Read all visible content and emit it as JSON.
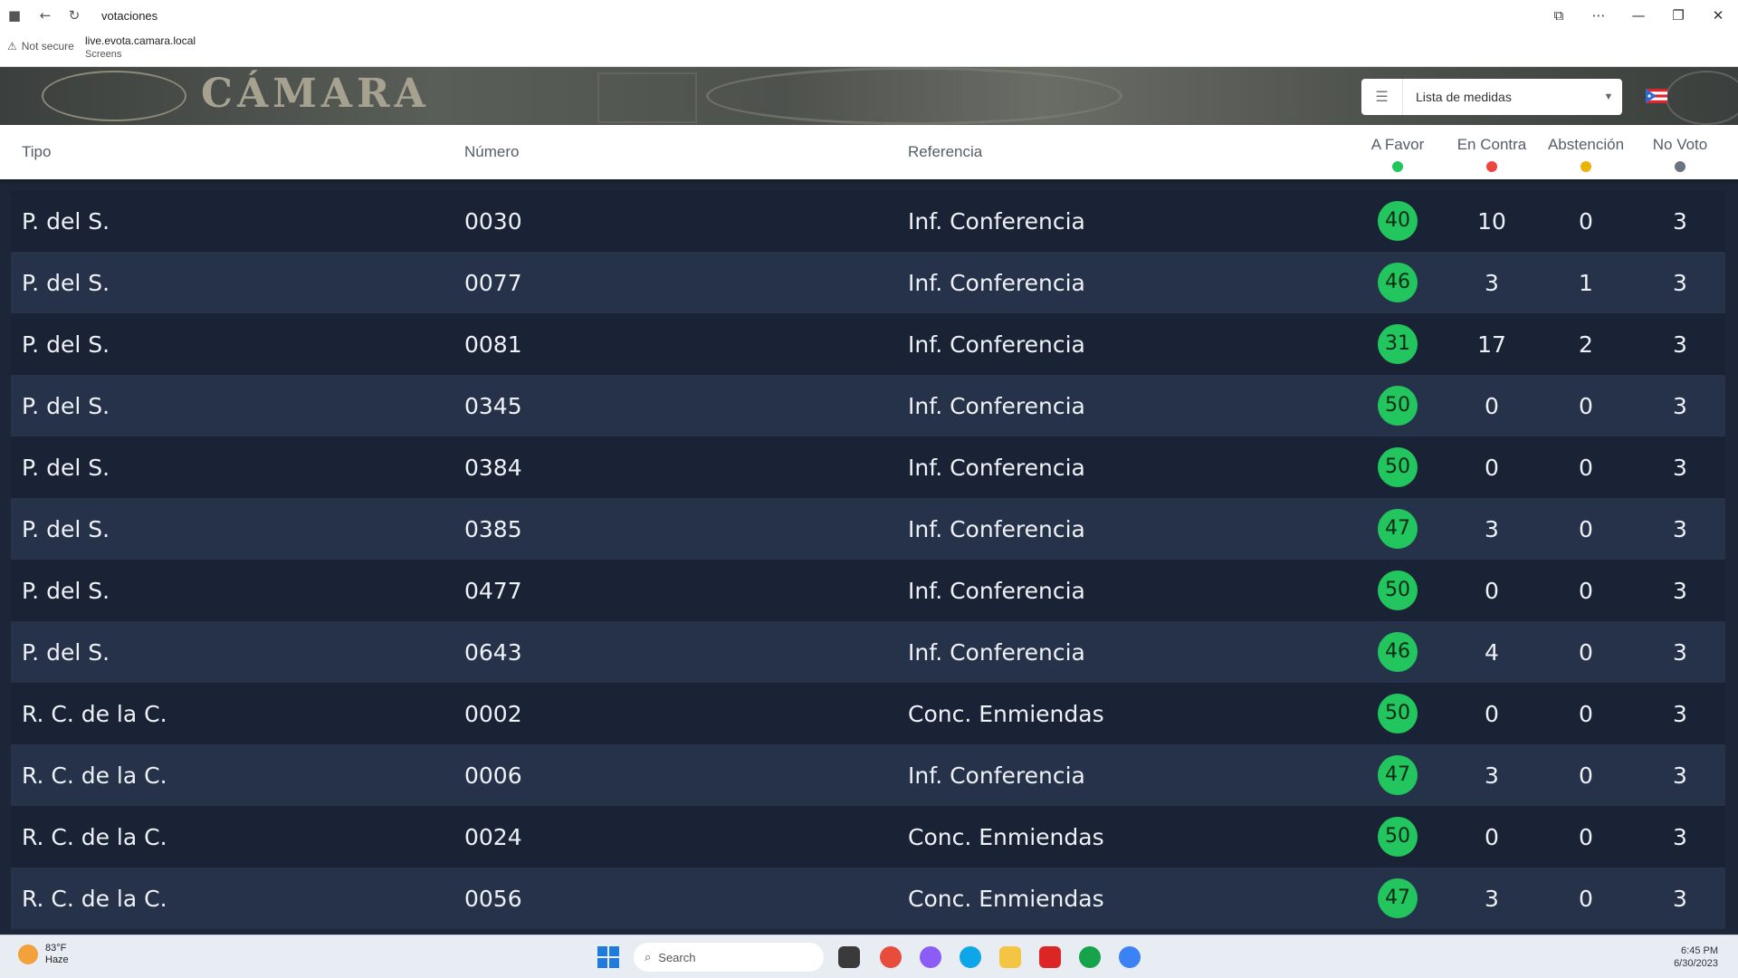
{
  "browser": {
    "title": "votaciones",
    "not_secure": "Not secure",
    "url": "live.evota.camara.local",
    "url_sub": "Screens"
  },
  "banner": {
    "logo": "CÁMARA"
  },
  "dropdown": {
    "label": "Lista de medidas",
    "icon": "list-icon"
  },
  "table": {
    "headers": {
      "tipo": "Tipo",
      "numero": "Número",
      "referencia": "Referencia",
      "favor": "A Favor",
      "contra": "En Contra",
      "abstencion": "Abstención",
      "novoto": "No Voto"
    },
    "colors": {
      "favor": "#22c55e",
      "contra": "#ef4444",
      "abstencion": "#eab308",
      "novoto": "#6b7280"
    },
    "rows": [
      {
        "tipo": "P. del S.",
        "numero": "0030",
        "referencia": "Inf. Conferencia",
        "favor": "40",
        "contra": "10",
        "abstencion": "0",
        "novoto": "3"
      },
      {
        "tipo": "P. del S.",
        "numero": "0077",
        "referencia": "Inf. Conferencia",
        "favor": "46",
        "contra": "3",
        "abstencion": "1",
        "novoto": "3"
      },
      {
        "tipo": "P. del S.",
        "numero": "0081",
        "referencia": "Inf. Conferencia",
        "favor": "31",
        "contra": "17",
        "abstencion": "2",
        "novoto": "3"
      },
      {
        "tipo": "P. del S.",
        "numero": "0345",
        "referencia": "Inf. Conferencia",
        "favor": "50",
        "contra": "0",
        "abstencion": "0",
        "novoto": "3"
      },
      {
        "tipo": "P. del S.",
        "numero": "0384",
        "referencia": "Inf. Conferencia",
        "favor": "50",
        "contra": "0",
        "abstencion": "0",
        "novoto": "3"
      },
      {
        "tipo": "P. del S.",
        "numero": "0385",
        "referencia": "Inf. Conferencia",
        "favor": "47",
        "contra": "3",
        "abstencion": "0",
        "novoto": "3"
      },
      {
        "tipo": "P. del S.",
        "numero": "0477",
        "referencia": "Inf. Conferencia",
        "favor": "50",
        "contra": "0",
        "abstencion": "0",
        "novoto": "3"
      },
      {
        "tipo": "P. del S.",
        "numero": "0643",
        "referencia": "Inf. Conferencia",
        "favor": "46",
        "contra": "4",
        "abstencion": "0",
        "novoto": "3"
      },
      {
        "tipo": "R. C. de la C.",
        "numero": "0002",
        "referencia": "Conc. Enmiendas",
        "favor": "50",
        "contra": "0",
        "abstencion": "0",
        "novoto": "3"
      },
      {
        "tipo": "R. C. de la C.",
        "numero": "0006",
        "referencia": "Inf. Conferencia",
        "favor": "47",
        "contra": "3",
        "abstencion": "0",
        "novoto": "3"
      },
      {
        "tipo": "R. C. de la C.",
        "numero": "0024",
        "referencia": "Conc. Enmiendas",
        "favor": "50",
        "contra": "0",
        "abstencion": "0",
        "novoto": "3"
      },
      {
        "tipo": "R. C. de la C.",
        "numero": "0056",
        "referencia": "Conc. Enmiendas",
        "favor": "47",
        "contra": "3",
        "abstencion": "0",
        "novoto": "3"
      }
    ]
  },
  "taskbar": {
    "weather_temp": "83°F",
    "weather_desc": "Haze",
    "search": "Search",
    "time": "6:45 PM",
    "date": "6/30/2023"
  }
}
